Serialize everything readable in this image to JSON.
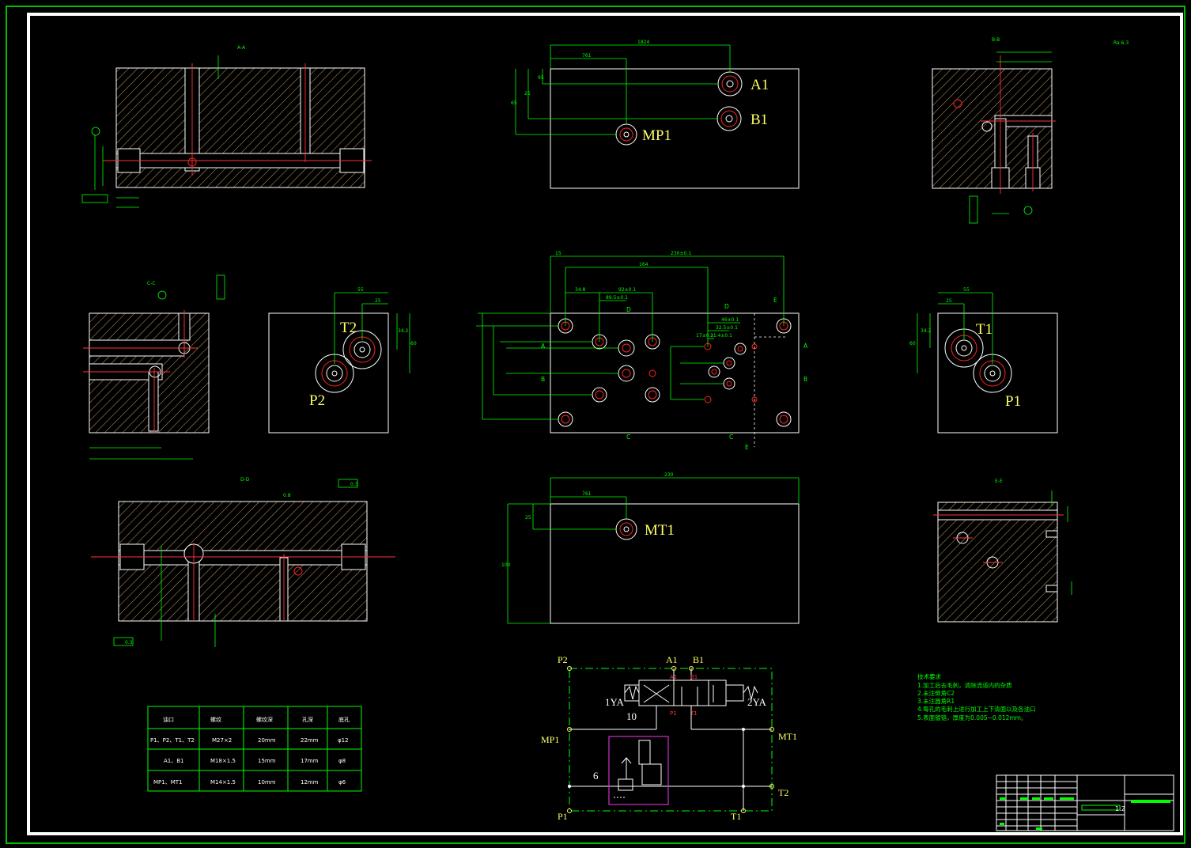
{
  "colors": {
    "background": "#000000",
    "outline": "#ffffff",
    "dimension": "#00ff00",
    "centerline": "#ff3333",
    "hatch": "#c8a060",
    "label": "#ffff66",
    "valve_box": "#cc33cc"
  },
  "sections": {
    "aa": "A-A",
    "bb": "B-B",
    "cc": "C-C",
    "dd": "D-D",
    "ee": "E-E"
  },
  "view_a1b1": {
    "holes": [
      "A1",
      "B1",
      "MP1"
    ],
    "dims": [
      "1824",
      "761",
      "95",
      "25",
      "65"
    ]
  },
  "view_t2p2": {
    "holes": [
      "T2",
      "P2"
    ],
    "dims": [
      "55",
      "25",
      "34.2",
      "60"
    ]
  },
  "view_t1p1": {
    "holes": [
      "T1",
      "P1"
    ],
    "dims": [
      "55",
      "25",
      "34.2",
      "60"
    ]
  },
  "view_mt1": {
    "holes": [
      "MT1"
    ],
    "dims": [
      "230",
      "761",
      "25",
      "100"
    ]
  },
  "view_main": {
    "dims": [
      "230±0.1",
      "15",
      "164",
      "34.8",
      "92±0.1",
      "89.5±0.1",
      "46±0.1",
      "32.5±0.1",
      "21.4±0.1",
      "17±0.1"
    ],
    "markers": [
      "A",
      "A",
      "B",
      "B",
      "C",
      "C",
      "D",
      "D",
      "E",
      "E"
    ]
  },
  "surface_marks": [
    "0.8",
    "0.3",
    "0.3",
    "0.3",
    "Ra 6.3"
  ],
  "port_table": {
    "headers": [
      "油口",
      "螺纹",
      "螺纹深",
      "孔深",
      "底孔"
    ],
    "rows": [
      [
        "P1、P2、T1、T2",
        "M27×2",
        "20mm",
        "22mm",
        "φ12"
      ],
      [
        "A1、B1",
        "M18×1.5",
        "15mm",
        "17mm",
        "φ8"
      ],
      [
        "MP1、MT1",
        "M14×1.5",
        "10mm",
        "12mm",
        "φ6"
      ]
    ]
  },
  "hydraulic": {
    "ports": [
      "P2",
      "A1",
      "B1",
      "MP1",
      "MT1",
      "P1",
      "T1",
      "T2"
    ],
    "solenoids": [
      "1YA",
      "2YA"
    ],
    "valve_ports": [
      "A1",
      "B1",
      "P1",
      "T1"
    ],
    "components": [
      "10",
      "6"
    ]
  },
  "tech_req": {
    "title": "技术要求",
    "lines": [
      "1.加工后去毛刺，清除流道内的杂质",
      "2.未注倒角C2",
      "3.未注圆角R1",
      "4.每孔的毛刺上进行加工上下清面以及各油口",
      "5.表面镀铬，厚度为0.005~0.012mm。"
    ]
  },
  "title_block": {
    "scale": "1:2"
  }
}
